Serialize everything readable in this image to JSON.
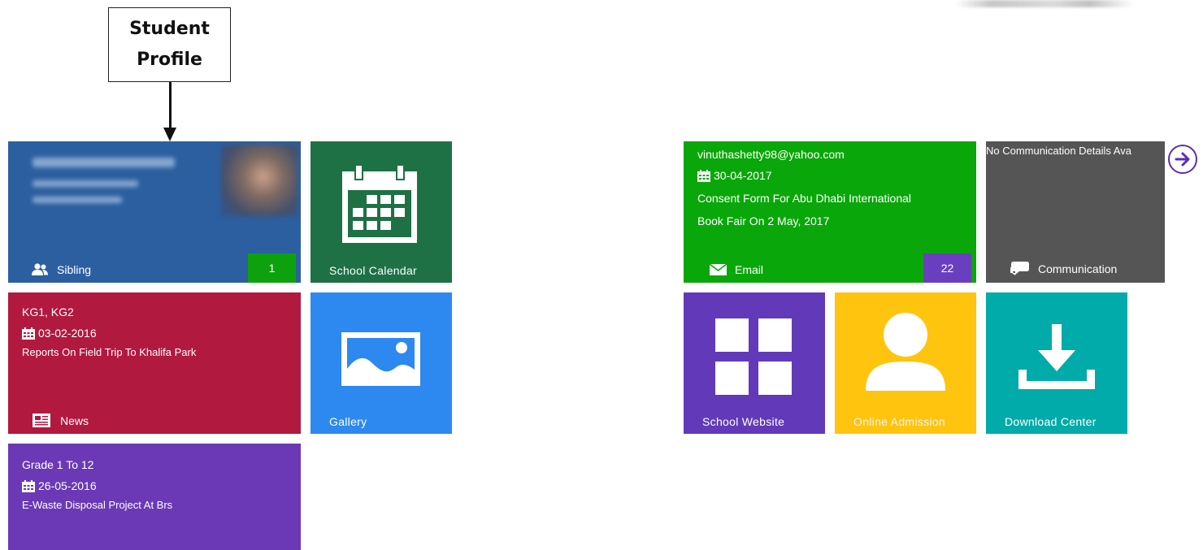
{
  "callout": {
    "line1": "Student",
    "line2": "Profile"
  },
  "tiles": {
    "profile": {
      "label": "Sibling",
      "count": "1"
    },
    "calendar": {
      "label": "School Calendar"
    },
    "news": {
      "class": "KG1, KG2",
      "date": "03-02-2016",
      "headline": "Reports On Field Trip To Khalifa Park",
      "label": "News"
    },
    "gallery": {
      "label": "Gallery"
    },
    "grade": {
      "class": "Grade 1 To 12",
      "date": "26-05-2016",
      "headline": "E-Waste Disposal Project At Brs"
    },
    "email": {
      "address": "vinuthashetty98@yahoo.com",
      "date": "30-04-2017",
      "subject_line1": "Consent Form For Abu Dhabi International",
      "subject_line2": "Book Fair On 2 May, 2017",
      "label": "Email",
      "count": "22"
    },
    "communication": {
      "notice": "No Communication Details Ava",
      "label": "Communication"
    },
    "website": {
      "label": "School Website"
    },
    "admission": {
      "label": "Online Admission"
    },
    "download": {
      "label": "Download Center"
    }
  },
  "colors": {
    "profile": "#2c5fa0",
    "calendar": "#1e7145",
    "news": "#b2193f",
    "gallery": "#2d89ef",
    "grade": "#6b39b5",
    "email": "#0aa70a",
    "communication": "#555555",
    "website": "#623ab9",
    "admission": "#ffc40d",
    "download": "#00aba9",
    "badge_green": "#0da20d",
    "badge_purple": "#6a3fbf"
  },
  "icons": {
    "sibling": "users-icon",
    "calendar": "calendar-icon",
    "news": "newspaper-icon",
    "gallery": "picture-icon",
    "email": "envelope-icon",
    "communication": "chat-bubbles-icon",
    "website": "grid-icon",
    "admission": "person-icon",
    "download": "download-icon",
    "next": "arrow-right-circle-icon"
  }
}
